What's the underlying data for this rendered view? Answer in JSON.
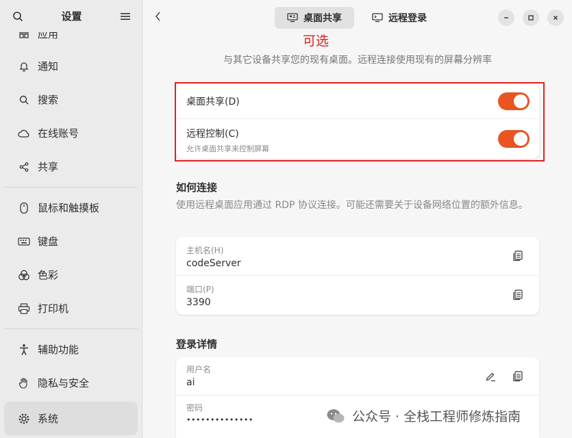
{
  "sidebar": {
    "title": "设置",
    "items": [
      {
        "label": "应用",
        "icon": "apps-icon"
      },
      {
        "label": "通知",
        "icon": "bell-icon"
      },
      {
        "label": "搜索",
        "icon": "search-icon"
      },
      {
        "label": "在线账号",
        "icon": "cloud-icon"
      },
      {
        "label": "共享",
        "icon": "share-icon"
      },
      {
        "label": "鼠标和触摸板",
        "icon": "mouse-icon"
      },
      {
        "label": "键盘",
        "icon": "keyboard-icon"
      },
      {
        "label": "色彩",
        "icon": "color-icon"
      },
      {
        "label": "打印机",
        "icon": "printer-icon"
      },
      {
        "label": "辅助功能",
        "icon": "accessibility-icon"
      },
      {
        "label": "隐私与安全",
        "icon": "hand-icon"
      },
      {
        "label": "系统",
        "icon": "gear-icon"
      }
    ]
  },
  "header": {
    "tabs": [
      {
        "label": "桌面共享",
        "icon": "desktop-share-icon",
        "active": true
      },
      {
        "label": "远程登录",
        "icon": "remote-login-icon",
        "active": false
      }
    ]
  },
  "annotation": {
    "text": "可选",
    "color": "#e02020"
  },
  "main": {
    "subtitle": "与其它设备共享您的现有桌面。远程连接使用现有的屏幕分辨率",
    "toggles": [
      {
        "label": "桌面共享(D)",
        "sub": "",
        "on": true
      },
      {
        "label": "远程控制(C)",
        "sub": "允许桌面共享来控制屏幕",
        "on": true
      }
    ],
    "connect": {
      "title": "如何连接",
      "desc": "使用远程桌面应用通过 RDP 协议连接。可能还需要关于设备网络位置的额外信息。",
      "hostname_label": "主机名(H)",
      "hostname_value": "codeServer",
      "port_label": "端口(P)",
      "port_value": "3390"
    },
    "login": {
      "title": "登录详情",
      "user_label": "用户名",
      "user_value": "ai",
      "pass_label": "密码",
      "pass_value": "••••••••••••••"
    }
  },
  "watermark": {
    "text": "公众号 · 全栈工程师修炼指南"
  },
  "colors": {
    "accent": "#e95420",
    "annotation_box": "#e0201e"
  }
}
